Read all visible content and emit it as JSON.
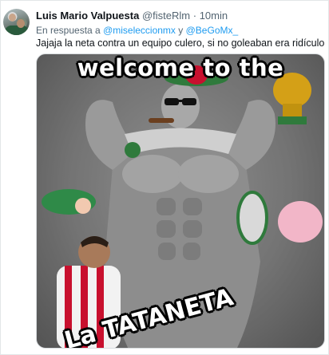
{
  "tweet": {
    "author_name": "Luis Mario Valpuesta",
    "author_handle": "@fisteRlm",
    "separator": "·",
    "time": "10min",
    "reply_prefix": "En respuesta a",
    "reply_mention_1": "@miseleccionmx",
    "reply_conjunction": "y",
    "reply_mention_2": "@BeGoMx_",
    "text": "Jajaja la neta contra un equipo culero, si no goleaban era ridículo"
  },
  "meme": {
    "caption_top": "welcome to the",
    "caption_bottom": "La TATANETA"
  },
  "colors": {
    "text": "#0f1419",
    "secondary": "#536471",
    "link": "#1d9bf0",
    "border": "#e3e6e8",
    "mexico_green": "#1f7a3a",
    "mexico_red": "#c8102e"
  }
}
